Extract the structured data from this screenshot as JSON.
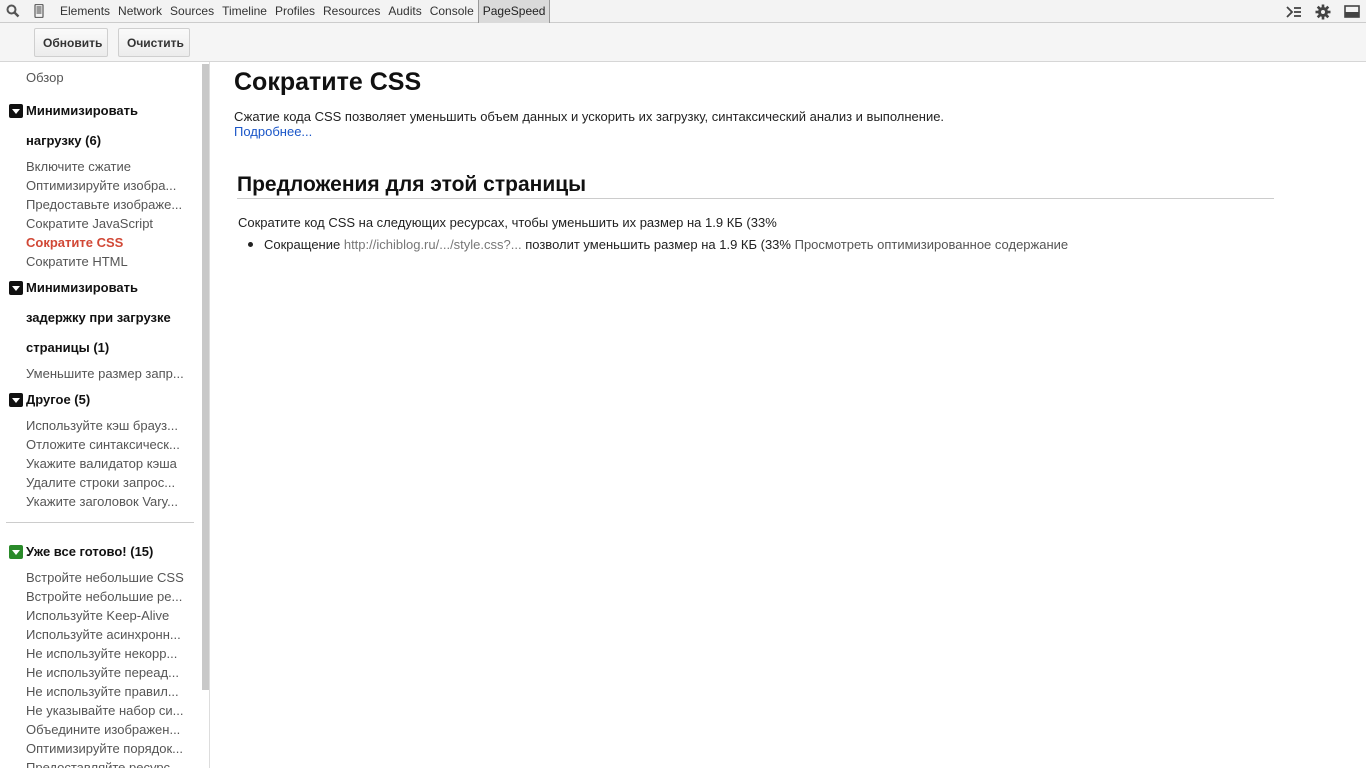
{
  "devtools": {
    "tabs": [
      "Elements",
      "Network",
      "Sources",
      "Timeline",
      "Profiles",
      "Resources",
      "Audits",
      "Console",
      "PageSpeed"
    ],
    "selected_tab": "PageSpeed"
  },
  "toolbar": {
    "refresh_label": "Обновить",
    "clear_label": "Очистить"
  },
  "sidebar": {
    "overview": "Обзор",
    "cat1": {
      "title_line1": "Минимизировать",
      "title_line2": "нагрузку (6)",
      "items": [
        "Включите сжатие",
        "Оптимизируйте изобра...",
        "Предоставьте изображе...",
        "Сократите JavaScript",
        "Сократите CSS",
        "Сократите HTML"
      ],
      "active_index": 4
    },
    "cat2": {
      "title_line1": "Минимизировать",
      "title_line2": "задержку при загрузке",
      "title_line3": "страницы (1)",
      "items": [
        "Уменьшите размер запр..."
      ]
    },
    "cat3": {
      "title": "Другое (5)",
      "items": [
        "Используйте кэш брауз...",
        "Отложите синтаксическ...",
        "Укажите валидатор кэша",
        "Удалите строки запрос...",
        "Укажите заголовок Vary..."
      ]
    },
    "cat4": {
      "title": "Уже все готово! (15)",
      "items": [
        "Встройте небольшие CSS",
        "Встройте небольшие ре...",
        "Используйте Keep-Alive",
        "Используйте асинхронн...",
        "Не используйте некорр...",
        "Не используйте переад...",
        "Не используйте правил...",
        "Не указывайте набор си...",
        "Объедините изображен...",
        "Оптимизируйте порядок...",
        "Предоставляйте ресурс..."
      ]
    }
  },
  "main": {
    "title": "Сократите CSS",
    "description": "Сжатие кода CSS позволяет уменьшить объем данных и ускорить их загрузку, синтаксический анализ и выполнение.",
    "more_link": "Подробнее...",
    "suggestions_title": "Предложения для этой страницы",
    "intro": "Сократите код CSS на следующих ресурсах, чтобы уменьшить их размер на 1.9 КБ (33%",
    "item": {
      "prefix": "Сокращение",
      "url": "http://ichiblog.ru/.../style.css?...",
      "suffix": "позволит уменьшить размер на 1.9 КБ (33%",
      "view_link": "Просмотреть оптимизированное содержание"
    }
  },
  "colors": {
    "active_item": "#d14836",
    "link": "#1a56c8",
    "ready_badge": "#2a8a2a"
  }
}
